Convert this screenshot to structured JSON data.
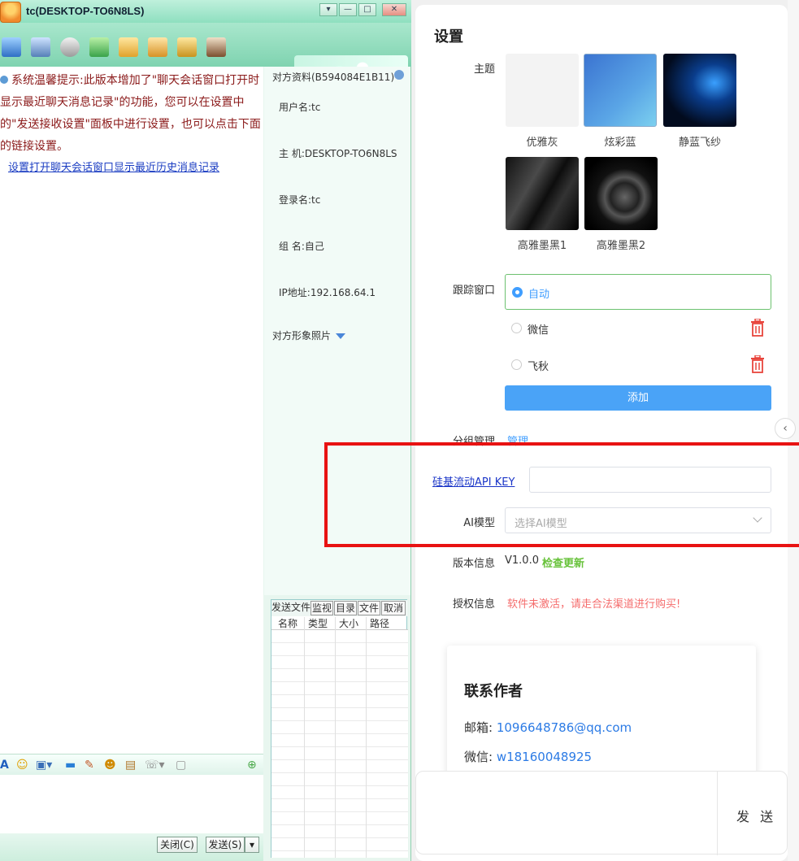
{
  "chat": {
    "title": "tc(DESKTOP-TO6N8LS)",
    "window_controls": [
      "▾",
      "—",
      "□",
      "✕"
    ],
    "system_message": "系统温馨提示:此版本增加了\"聊天会话窗口打开时显示最近聊天消息记录\"的功能，您可以在设置中的\"发送接收设置\"面板中进行设置，也可以点击下面的链接设置。",
    "system_link": "设置打开聊天会话窗口显示最近历史消息记录",
    "close_button": "关闭(C)",
    "send_button": "发送(S)",
    "send_dropdown": "▾"
  },
  "peer_info": {
    "header": "对方资料(B594084E1B11)",
    "username": "用户名:tc",
    "host": "主  机:DESKTOP-TO6N8LS",
    "login": "登录名:tc",
    "group": "组  名:自己",
    "ip": "IP地址:192.168.64.1",
    "photo_label": "对方形象照片"
  },
  "file_panel": {
    "tabs": [
      "发送文件",
      "监视",
      "目录",
      "文件",
      "取消"
    ],
    "columns": [
      "名称",
      "类型",
      "大小",
      "路径"
    ]
  },
  "settings": {
    "title": "设置",
    "theme_label": "主题",
    "themes": [
      {
        "name": "优雅灰"
      },
      {
        "name": "炫彩蓝"
      },
      {
        "name": "静蓝飞纱"
      },
      {
        "name": "高雅墨黑1"
      },
      {
        "name": "高雅墨黑2"
      }
    ],
    "tracking_label": "跟踪窗口",
    "tracking_options": [
      {
        "label": "自动",
        "selected": true
      },
      {
        "label": "微信",
        "selected": false
      },
      {
        "label": "飞秋",
        "selected": false
      }
    ],
    "add_button": "添加",
    "group_label": "分组管理",
    "group_link": "管理",
    "api_key_link": "硅基流动API KEY",
    "api_key_value": "",
    "ai_model_label": "AI模型",
    "ai_model_placeholder": "选择AI模型",
    "version_label": "版本信息",
    "version_value": "V1.0.0",
    "check_update": "检查更新",
    "license_label": "授权信息",
    "license_value": "软件未激活，请走合法渠道进行购买!",
    "accent_color": "#409eff",
    "warning_color": "#f56c6c",
    "success_color": "#67c23a"
  },
  "contact": {
    "title": "联系作者",
    "email_label": "邮箱: ",
    "email": "1096648786@qq.com",
    "wechat_label": "微信: ",
    "wechat": "w18160048925"
  },
  "send_box": {
    "button": "发 送"
  }
}
